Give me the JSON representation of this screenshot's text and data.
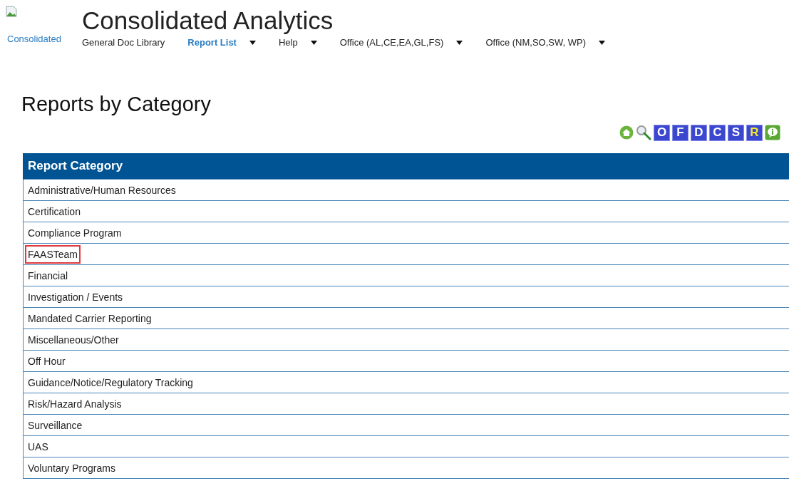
{
  "logo": {
    "caption": "Consolidated"
  },
  "app_title": "Consolidated Analytics",
  "nav": [
    {
      "label": "General Doc Library",
      "selected": false,
      "dropdown": false
    },
    {
      "label": "Report List",
      "selected": true,
      "dropdown": true
    },
    {
      "label": "Help",
      "selected": false,
      "dropdown": true
    },
    {
      "label": "Office (AL,CE,EA,GL,FS)",
      "selected": false,
      "dropdown": true
    },
    {
      "label": "Office (NM,SO,SW, WP)",
      "selected": false,
      "dropdown": true
    }
  ],
  "page_title": "Reports by Category",
  "toolbar": [
    {
      "kind": "home"
    },
    {
      "kind": "search"
    },
    {
      "kind": "letter",
      "label": "O",
      "selected": false
    },
    {
      "kind": "letter",
      "label": "F",
      "selected": false
    },
    {
      "kind": "letter",
      "label": "D",
      "selected": false
    },
    {
      "kind": "letter",
      "label": "C",
      "selected": false
    },
    {
      "kind": "letter",
      "label": "S",
      "selected": false
    },
    {
      "kind": "letter",
      "label": "R",
      "selected": true
    },
    {
      "kind": "info"
    }
  ],
  "table": {
    "columns": [
      "Report Category"
    ],
    "rows": [
      {
        "label": "Administrative/Human Resources",
        "highlighted": false
      },
      {
        "label": "Certification",
        "highlighted": false
      },
      {
        "label": "Compliance Program",
        "highlighted": false
      },
      {
        "label": "FAASTeam",
        "highlighted": true
      },
      {
        "label": "Financial",
        "highlighted": false
      },
      {
        "label": "Investigation / Events",
        "highlighted": false
      },
      {
        "label": "Mandated Carrier Reporting",
        "highlighted": false
      },
      {
        "label": "Miscellaneous/Other",
        "highlighted": false
      },
      {
        "label": "Off Hour",
        "highlighted": false
      },
      {
        "label": "Guidance/Notice/Regulatory Tracking",
        "highlighted": false
      },
      {
        "label": "Risk/Hazard Analysis",
        "highlighted": false
      },
      {
        "label": "Surveillance",
        "highlighted": false
      },
      {
        "label": "UAS",
        "highlighted": false
      },
      {
        "label": "Voluntary Programs",
        "highlighted": false
      }
    ]
  }
}
